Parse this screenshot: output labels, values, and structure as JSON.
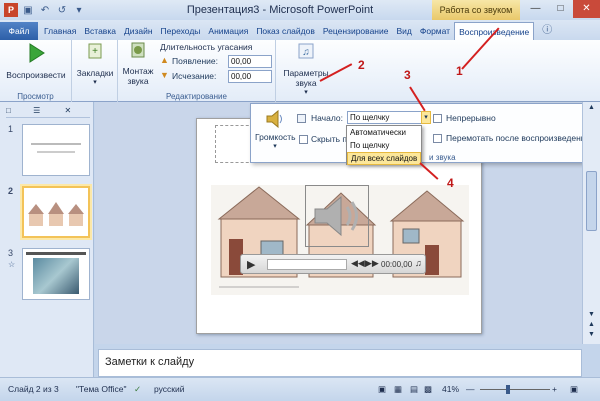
{
  "window": {
    "title": "Презентация3 - Microsoft PowerPoint",
    "context_tab": "Работа со звуком"
  },
  "tabs": [
    "Главная",
    "Вставка",
    "Дизайн",
    "Переходы",
    "Анимация",
    "Показ слайдов",
    "Рецензирование",
    "Вид",
    "Формат",
    "Воспроизведение"
  ],
  "file_tab": "Файл",
  "ribbon": {
    "preview": {
      "play_label": "Воспроизвести",
      "group": "Просмотр"
    },
    "bookmarks": {
      "label": "Закладки"
    },
    "edit": {
      "trim_label": "Монтаж звука",
      "fade_title": "Длительность угасания",
      "fade_in_label": "Появление:",
      "fade_in_value": "00,00",
      "fade_out_label": "Исчезание:",
      "fade_out_value": "00,00",
      "group": "Редактирование"
    },
    "params": {
      "label": "Параметры звука"
    }
  },
  "popup": {
    "volume_label": "Громкость",
    "hide_label": "Скрыть п",
    "start_label": "Начало:",
    "start_value": "По щелчку",
    "loop_label": "Непрерывно",
    "rewind_label": "Перемотать после воспроизведения",
    "group_suffix": "и звука"
  },
  "dropdown": {
    "options": [
      "Автоматически",
      "По щелчку",
      "Для всех слайдов"
    ]
  },
  "player": {
    "time": "00:00,00"
  },
  "thumbnails": [
    {
      "num": "1"
    },
    {
      "num": "2"
    },
    {
      "num": "3"
    }
  ],
  "notes": {
    "placeholder": "Заметки к слайду"
  },
  "status": {
    "slide": "Слайд 2 из 3",
    "theme": "\"Тема Office\"",
    "lang": "русский",
    "zoom": "41%"
  },
  "annotations": [
    "1",
    "2",
    "3",
    "4"
  ]
}
